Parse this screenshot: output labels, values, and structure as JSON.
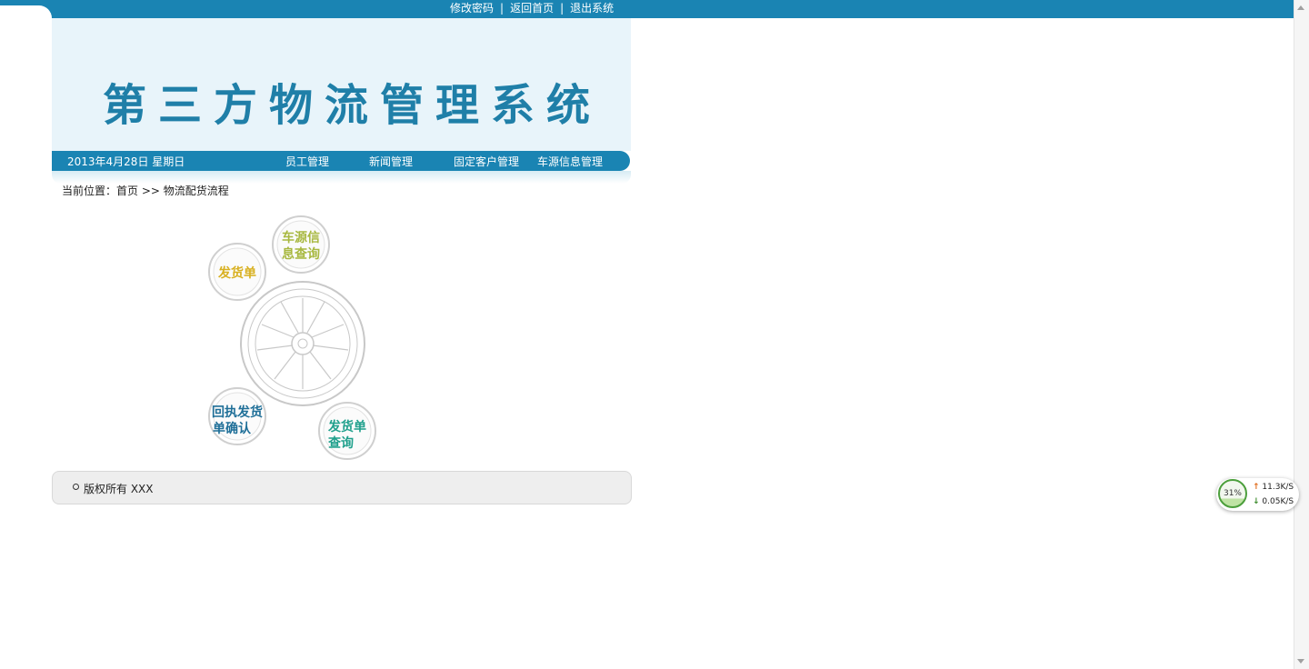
{
  "header": {
    "links": [
      {
        "label": "修改密码"
      },
      {
        "label": "返回首页"
      },
      {
        "label": "退出系统"
      }
    ],
    "separator": "|",
    "title": "第三方物流管理系统"
  },
  "nav": {
    "date": "2013年4月28日 星期日",
    "items": [
      {
        "label": "员工管理"
      },
      {
        "label": "新闻管理"
      },
      {
        "label": "固定客户管理"
      },
      {
        "label": "车源信息管理"
      }
    ]
  },
  "breadcrumb": {
    "prefix": "当前位置：",
    "home": "首页",
    "sep": ">>",
    "current": "物流配货流程"
  },
  "diagram": {
    "nodes": [
      {
        "line1": "车源信",
        "line2": "息查询",
        "color": "#a8b840"
      },
      {
        "line1": "发货单",
        "line2": "",
        "color": "#d8b020"
      },
      {
        "line1": "回执发货",
        "line2": "单确认",
        "color": "#1f6f98"
      },
      {
        "line1": "发货单",
        "line2": "查询",
        "color": "#1fa08c"
      }
    ]
  },
  "footer": {
    "copyright": "版权所有 XXX"
  },
  "net_widget": {
    "percent": "31%",
    "upload": "11.3K/S",
    "download": "0.05K/S"
  }
}
